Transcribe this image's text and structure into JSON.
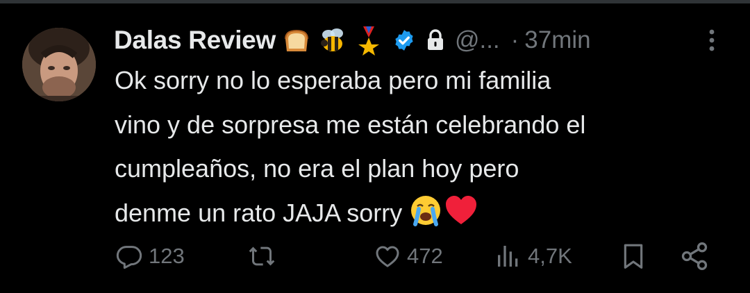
{
  "tweet": {
    "author": {
      "display_name": "Dalas Review",
      "handle": "@...",
      "verified": true,
      "protected": true,
      "badge_icons": [
        "bread-emoji",
        "bee-emoji",
        "medal-emoji"
      ]
    },
    "separator": "·",
    "time": "37min",
    "text_lines": [
      "Ok sorry no lo esperaba pero mi familia",
      "vino y de sorpresa me están celebrando el",
      "cumpleaños, no era el plan hoy pero",
      "denme un rato JAJA sorry "
    ],
    "text_trailing_icons": [
      "crying-face-emoji",
      "red-heart-emoji"
    ],
    "actions": {
      "replies": "123",
      "reposts": "",
      "likes": "472",
      "views": "4,7K"
    }
  },
  "colors": {
    "background": "#000000",
    "text": "#e7e9ea",
    "muted": "#71767b",
    "verified_blue": "#1d9bf0",
    "divider": "#2f3336"
  }
}
